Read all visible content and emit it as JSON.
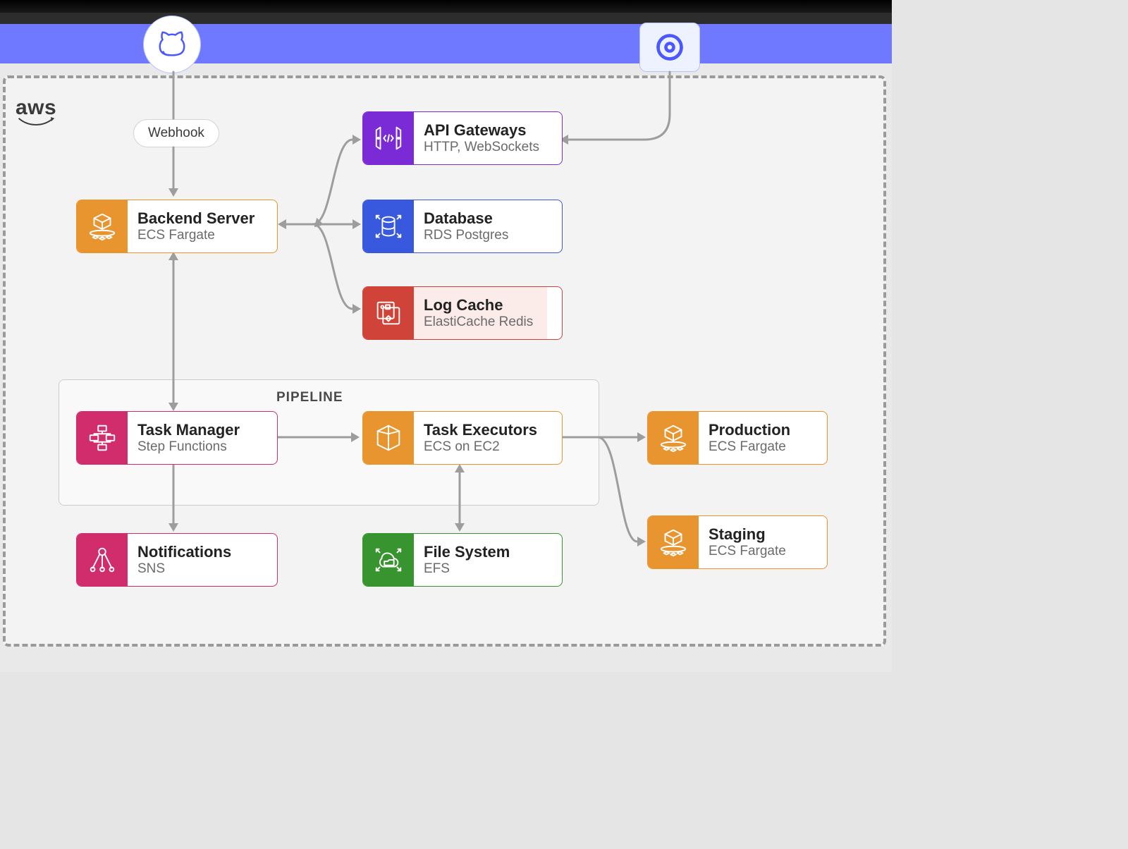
{
  "brand": {
    "title": "aws"
  },
  "top": {
    "source_icon": "cat-icon",
    "ctl_icon": "spiral-icon",
    "webhook_label": "Webhook"
  },
  "pipeline": {
    "title": "PIPELINE"
  },
  "nodes": {
    "backend": {
      "title": "Backend Server",
      "sub": "ECS Fargate"
    },
    "api": {
      "title": "API Gateways",
      "sub": "HTTP, WebSockets"
    },
    "db": {
      "title": "Database",
      "sub": "RDS Postgres"
    },
    "logcache": {
      "title": "Log Cache",
      "sub": "ElastiCache Redis"
    },
    "taskmgr": {
      "title": "Task Manager",
      "sub": "Step Functions"
    },
    "executors": {
      "title": "Task Executors",
      "sub": "ECS on EC2"
    },
    "notif": {
      "title": "Notifications",
      "sub": "SNS"
    },
    "fs": {
      "title": "File System",
      "sub": "EFS"
    },
    "prod": {
      "title": "Production",
      "sub": "ECS Fargate"
    },
    "staging": {
      "title": "Staging",
      "sub": "ECS Fargate"
    }
  },
  "colors": {
    "orange": "#e8952f",
    "purple": "#7a2bd6",
    "blue": "#3858dd",
    "red": "#cf4339",
    "pink": "#d12c6b",
    "green": "#38942f",
    "banner": "#6e79ff",
    "edge": "#9d9d9d"
  }
}
